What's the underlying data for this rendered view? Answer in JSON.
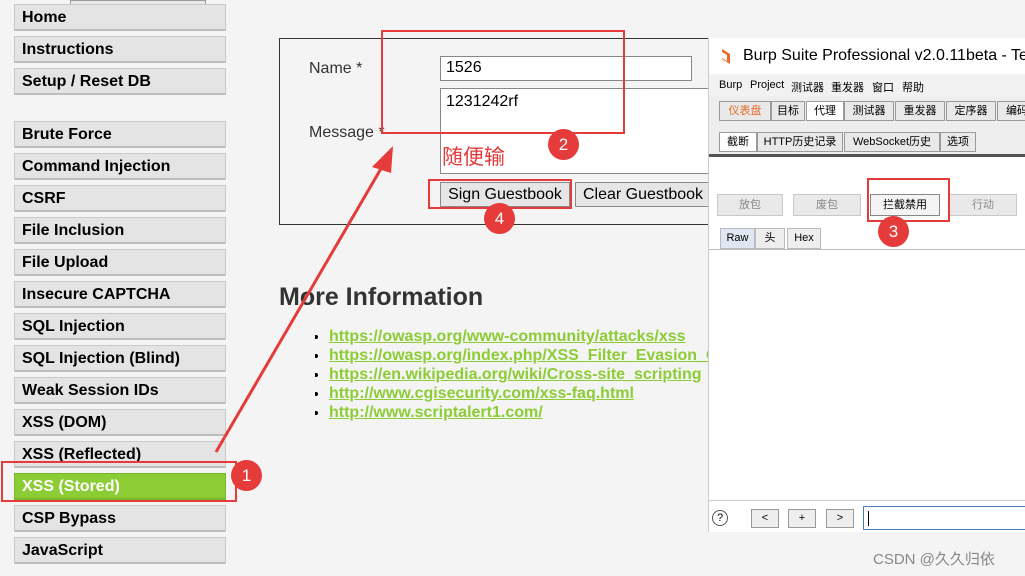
{
  "sidebar": {
    "items": [
      {
        "label": "Home"
      },
      {
        "label": "Instructions"
      },
      {
        "label": "Setup / Reset DB"
      },
      {
        "label": "Brute Force"
      },
      {
        "label": "Command Injection"
      },
      {
        "label": "CSRF"
      },
      {
        "label": "File Inclusion"
      },
      {
        "label": "File Upload"
      },
      {
        "label": "Insecure CAPTCHA"
      },
      {
        "label": "SQL Injection"
      },
      {
        "label": "SQL Injection (Blind)"
      },
      {
        "label": "Weak Session IDs"
      },
      {
        "label": "XSS (DOM)"
      },
      {
        "label": "XSS (Reflected)"
      },
      {
        "label": "XSS (Stored)"
      },
      {
        "label": "CSP Bypass"
      },
      {
        "label": "JavaScript"
      }
    ],
    "active_item": "XSS (Stored)",
    "active_color": "#8ccc34"
  },
  "form": {
    "name_label": "Name *",
    "name_value": "1526",
    "message_label": "Message *",
    "message_value": "1231242rf",
    "sign_button": "Sign Guestbook",
    "clear_button": "Clear Guestbook"
  },
  "more_info": {
    "title": "More Information",
    "links": [
      "https://owasp.org/www-community/attacks/xss",
      "https://owasp.org/index.php/XSS_Filter_Evasion_Cheat_Sheet",
      "https://en.wikipedia.org/wiki/Cross-site_scripting",
      "http://www.cgisecurity.com/xss-faq.html",
      "http://www.scriptalert1.com/"
    ],
    "link_color": "#8ccc34"
  },
  "burp": {
    "title": "Burp Suite Professional v2.0.11beta - Te",
    "menu": [
      "Burp",
      "Project",
      "测试器",
      "重发器",
      "窗口",
      "帮助"
    ],
    "main_tabs": [
      "仪表盘",
      "目标",
      "代理",
      "测试器",
      "重发器",
      "定序器",
      "编码"
    ],
    "main_tab_selected": "代理",
    "proxy_tabs": [
      "截断",
      "HTTP历史记录",
      "WebSocket历史",
      "选项"
    ],
    "proxy_tab_selected": "截断",
    "buttons": {
      "forward": "放包",
      "drop": "废包",
      "intercept": "拦截禁用",
      "action": "行动"
    },
    "view_tabs": [
      "Raw",
      "头",
      "Hex"
    ],
    "bottom": {
      "help": "?",
      "prev": "<",
      "add": "+",
      "next": ">"
    },
    "accent": "#e56a2a"
  },
  "annotations": {
    "badge1": "1",
    "badge2": "2",
    "badge3": "3",
    "badge4": "4",
    "note": "随便输",
    "color": "#e63b3b"
  },
  "watermark": "CSDN @久久归依"
}
